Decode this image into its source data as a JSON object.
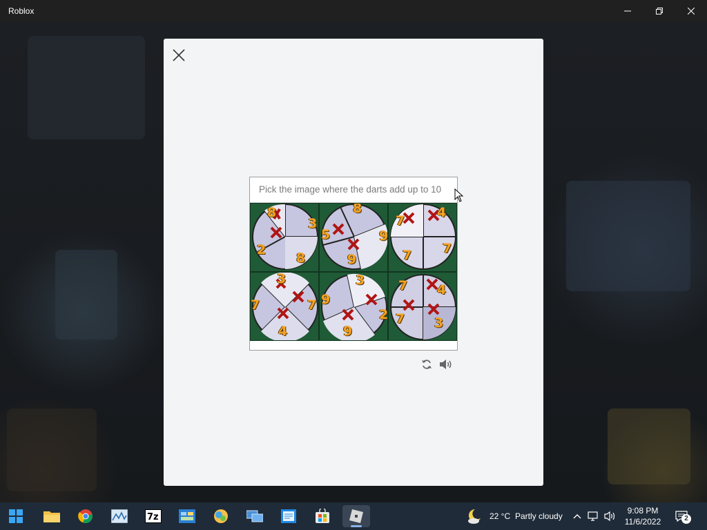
{
  "window": {
    "title": "Roblox"
  },
  "captcha": {
    "prompt": "Pick the image where the darts add up to 10",
    "tiles": [
      {
        "numbers": [
          "8",
          "3",
          "2",
          "8"
        ]
      },
      {
        "numbers": [
          "8",
          "5",
          "9",
          "9"
        ]
      },
      {
        "numbers": [
          "7",
          "4",
          "7",
          "7"
        ]
      },
      {
        "numbers": [
          "3",
          "7",
          "7",
          "4"
        ]
      },
      {
        "numbers": [
          "3",
          "9",
          "2",
          "9"
        ]
      },
      {
        "numbers": [
          "7",
          "4",
          "7",
          "3"
        ]
      }
    ],
    "refresh_icon": "refresh-icon",
    "audio_icon": "audio-icon"
  },
  "taskbar": {
    "apps": [
      "start-icon",
      "file-explorer-icon",
      "chrome-icon",
      "resource-monitor-icon",
      "7zip-icon",
      "control-panel-icon",
      "photos-icon",
      "remote-desktop-icon",
      "notepad-icon",
      "store-icon",
      "roblox-icon"
    ],
    "weather": {
      "temp": "22 °C",
      "desc": "Partly cloudy"
    },
    "clock": {
      "time": "9:08 PM",
      "date": "11/6/2022"
    },
    "notifications": "2"
  }
}
